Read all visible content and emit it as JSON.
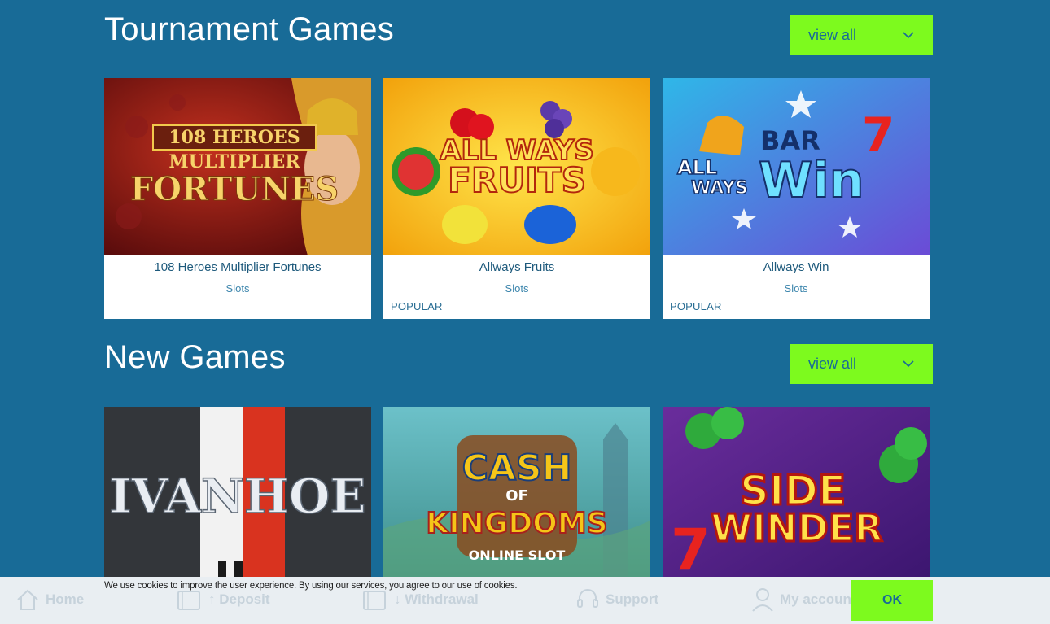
{
  "sections": [
    {
      "title": "Tournament Games",
      "view_all_label": "view all",
      "games": [
        {
          "name": "108 Heroes Multiplier Fortunes",
          "category": "Slots",
          "badge": "",
          "art_lines": [
            "108 HEROES",
            "MULTIPLIER",
            "FORTUNES"
          ]
        },
        {
          "name": "Allways Fruits",
          "category": "Slots",
          "badge": "POPULAR",
          "art_lines": [
            "ALL WAYS",
            "FRUITS"
          ]
        },
        {
          "name": "Allways Win",
          "category": "Slots",
          "badge": "POPULAR",
          "art_lines": [
            "BAR",
            "ALL",
            "WAYS",
            "Win"
          ]
        }
      ]
    },
    {
      "title": "New Games",
      "view_all_label": "view all",
      "games": [
        {
          "name": "",
          "category": "",
          "badge": "",
          "art_lines": [
            "IVANHOE"
          ]
        },
        {
          "name": "",
          "category": "",
          "badge": "",
          "art_lines": [
            "CASH",
            "OF",
            "KINGDOMS",
            "ONLINE SLOT"
          ]
        },
        {
          "name": "",
          "category": "",
          "badge": "",
          "art_lines": [
            "SIDE",
            "WINDER"
          ]
        }
      ]
    }
  ],
  "bottom_nav": {
    "items": [
      {
        "label": "Home",
        "icon": "home-icon"
      },
      {
        "label": "↑ Deposit",
        "icon": "wallet-icon"
      },
      {
        "label": "↓ Withdrawal",
        "icon": "wallet-icon"
      },
      {
        "label": "Support",
        "icon": "headset-icon"
      },
      {
        "label": "My accoun",
        "icon": "user-icon"
      }
    ]
  },
  "cookie": {
    "text": "We use cookies to improve the user experience. By using our services, you agree to our use of cookies.",
    "ok_label": "OK"
  },
  "colors": {
    "background": "#186b97",
    "accent": "#7dfa1e",
    "card": "#ffffff"
  }
}
